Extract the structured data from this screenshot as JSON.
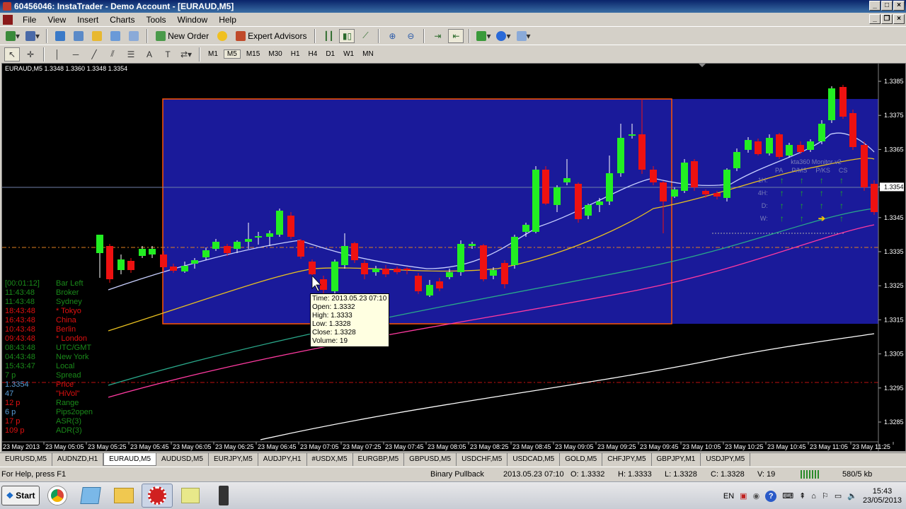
{
  "window": {
    "title": "60456046: InstaTrader - Demo Account - [EURAUD,M5]"
  },
  "menu": [
    "File",
    "View",
    "Insert",
    "Charts",
    "Tools",
    "Window",
    "Help"
  ],
  "toolbar1": {
    "new_order": "New Order",
    "expert_advisors": "Expert Advisors"
  },
  "timeframes": [
    "M1",
    "M5",
    "M15",
    "M30",
    "H1",
    "H4",
    "D1",
    "W1",
    "MN"
  ],
  "active_timeframe": "M5",
  "chart": {
    "header": "EURAUD,M5  1.3348 1.3360 1.3348 1.3354",
    "price_labels": [
      "1.3385",
      "1.3375",
      "1.3365",
      "1.3354",
      "1.3345",
      "1.3335",
      "1.3325",
      "1.3315",
      "1.3305",
      "1.3295",
      "1.3285"
    ],
    "time_labels": [
      "23 May 2013",
      "23 May 05:05",
      "23 May 05:25",
      "23 May 05:45",
      "23 May 06:05",
      "23 May 06:25",
      "23 May 06:45",
      "23 May 07:05",
      "23 May 07:25",
      "23 May 07:45",
      "23 May 08:05",
      "23 May 08:25",
      "23 May 08:45",
      "23 May 09:05",
      "23 May 09:25",
      "23 May 09:45",
      "23 May 10:05",
      "23 May 10:25",
      "23 May 10:45",
      "23 May 11:05",
      "23 May 11:25"
    ]
  },
  "monitor": {
    "title": "kta360 Monitor v2",
    "columns": [
      "PA",
      "P/MS",
      "P/KS",
      "CS"
    ],
    "rows": [
      {
        "label": "1H:",
        "arrows": [
          "up",
          "up",
          "up",
          "up"
        ]
      },
      {
        "label": "4H:",
        "arrows": [
          "up",
          "up",
          "up",
          "up"
        ]
      },
      {
        "label": "D:",
        "arrows": [
          "up",
          "up",
          "up",
          "up"
        ]
      },
      {
        "label": "W:",
        "arrows": [
          "up",
          "up",
          "right",
          "up"
        ]
      }
    ]
  },
  "tooltip": {
    "time": "Time: 2013.05.23 07:10",
    "open": "Open: 1.3332",
    "high": "High: 1.3333",
    "low": "Low:  1.3328",
    "close": "Close: 1.3328",
    "volume": "Volume: 19"
  },
  "clocks": [
    {
      "time": "[00:01:12]",
      "name": "Bar Left",
      "color": "#1a8a1a",
      "ncolor": "#1a8a1a"
    },
    {
      "time": "11:43:48",
      "name": "Broker",
      "color": "#1a8a1a",
      "ncolor": "#1a8a1a"
    },
    {
      "time": "11:43:48",
      "name": "Sydney",
      "color": "#1a8a1a",
      "ncolor": "#1a8a1a"
    },
    {
      "time": "18:43:48",
      "name": "* Tokyo",
      "color": "#e01010",
      "ncolor": "#e01010"
    },
    {
      "time": "16:43:48",
      "name": "China",
      "color": "#e01010",
      "ncolor": "#e01010"
    },
    {
      "time": "10:43:48",
      "name": "Berlin",
      "color": "#e01010",
      "ncolor": "#e01010"
    },
    {
      "time": "09:43:48",
      "name": "* London",
      "color": "#e01010",
      "ncolor": "#e01010"
    },
    {
      "time": "08:43:48",
      "name": "UTC/GMT",
      "color": "#1a8a1a",
      "ncolor": "#1a8a1a"
    },
    {
      "time": "04:43:48",
      "name": "New York",
      "color": "#1a8a1a",
      "ncolor": "#1a8a1a"
    },
    {
      "time": "15:43:47",
      "name": "Local",
      "color": "#1a8a1a",
      "ncolor": "#1a8a1a"
    },
    {
      "time": "7 p",
      "name": "Spread",
      "color": "#1a8a1a",
      "ncolor": "#1a8a1a"
    },
    {
      "time": "1.3354",
      "name": "Price",
      "color": "#5a9ed8",
      "ncolor": "#e01010"
    },
    {
      "time": "47",
      "name": "\"HiVol\"",
      "color": "#5a9ed8",
      "ncolor": "#e01010"
    },
    {
      "time": "12 p",
      "name": "Range",
      "color": "#e01010",
      "ncolor": "#1a8a1a"
    },
    {
      "time": "6 p",
      "name": "Pips2open",
      "color": "#5a9ed8",
      "ncolor": "#1a8a1a"
    },
    {
      "time": "17 p",
      "name": "ASR(3)",
      "color": "#e01010",
      "ncolor": "#1a8a1a"
    },
    {
      "time": "109 p",
      "name": "ADR(3)",
      "color": "#e01010",
      "ncolor": "#1a8a1a"
    }
  ],
  "tabs": [
    "EURUSD,M5",
    "AUDNZD,H1",
    "EURAUD,M5",
    "AUDUSD,M5",
    "EURJPY,M5",
    "AUDJPY,H1",
    "#USDX,M5",
    "EURGBP,M5",
    "GBPUSD,M5",
    "USDCHF,M5",
    "USDCAD,M5",
    "GOLD,M5",
    "CHFJPY,M5",
    "GBPJPY,M1",
    "USDJPY,M5"
  ],
  "active_tab": "EURAUD,M5",
  "status": {
    "help": "For Help, press F1",
    "profile": "Binary Pullback",
    "datetime": "2013.05.23 07:10",
    "open": "O: 1.3332",
    "high": "H: 1.3333",
    "low": "L: 1.3328",
    "close": "C: 1.3328",
    "volume": "V: 19",
    "traffic": "580/5 kb"
  },
  "taskbar": {
    "start": "Start",
    "lang": "EN",
    "time": "15:43",
    "date": "23/05/2013"
  },
  "colors": {
    "bull": "#22ee22",
    "bear": "#ee1111",
    "box_fill": "#1a1a9a",
    "box_border": "#ff5500"
  }
}
